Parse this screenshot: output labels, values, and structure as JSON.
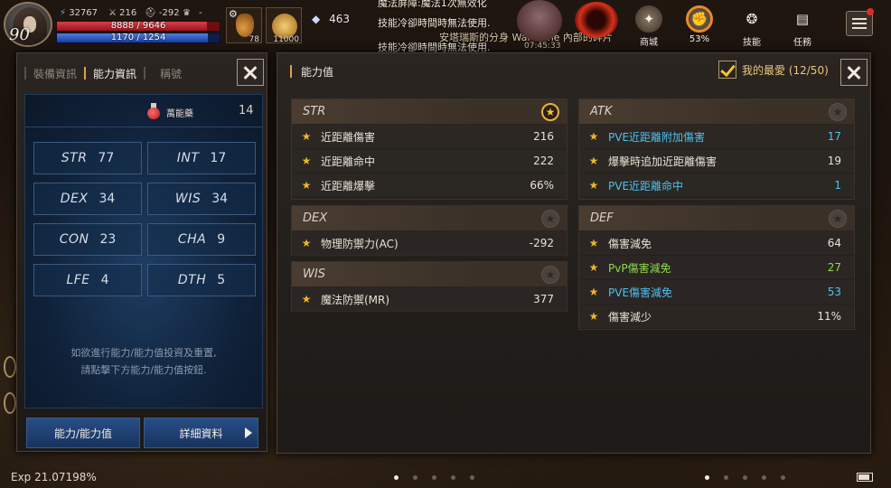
{
  "player": {
    "level": "90",
    "power": "32767",
    "attack_stat": "216",
    "defense_stat": "-292",
    "trophy_stat": "-",
    "hp_text": "8888 / 9646",
    "hp_ratio": 0.92,
    "mp_text": "1170 / 1254",
    "mp_ratio": 0.93
  },
  "quick_slots": [
    {
      "icon": "potion-slot-icon",
      "count": "78"
    },
    {
      "icon": "scroll-slot-icon",
      "count": "11000"
    }
  ],
  "crystal_count": "463",
  "system_messages": [
    "魔法屏障:魔法1次無效化",
    "技能冷卻時間時無法使用.",
    "安塔瑞斯的分身 War Zone 內部的碎片",
    "技能冷卻時間時無法使用."
  ],
  "timer_text": "07:45:33",
  "top_menu": [
    {
      "label": "商城",
      "icon": "shop-icon",
      "glyph": "✦"
    },
    {
      "label": "53%",
      "icon": "weight-icon",
      "glyph": "✊"
    },
    {
      "label": "技能",
      "icon": "skill-icon",
      "glyph": "❂"
    },
    {
      "label": "任務",
      "icon": "quest-icon",
      "glyph": "▤"
    }
  ],
  "left_panel": {
    "tabs": [
      {
        "label": "裝備資訊",
        "active": false
      },
      {
        "label": "能力資訊",
        "active": true
      },
      {
        "label": "稱號",
        "active": false
      }
    ],
    "potion_label": "萬能藥",
    "potion_count": "14",
    "stats": [
      {
        "key": "STR",
        "value": "77"
      },
      {
        "key": "INT",
        "value": "17"
      },
      {
        "key": "DEX",
        "value": "34"
      },
      {
        "key": "WIS",
        "value": "34"
      },
      {
        "key": "CON",
        "value": "23"
      },
      {
        "key": "CHA",
        "value": "9"
      },
      {
        "key": "LFE",
        "value": "4"
      },
      {
        "key": "DTH",
        "value": "5"
      }
    ],
    "hint_line1": "如欲進行能力/能力值投資及重置,",
    "hint_line2": "請點擊下方能力/能力值按鈕.",
    "button_ability": "能力/能力值",
    "button_details": "詳細資料"
  },
  "right_panel": {
    "title": "能力值",
    "favorite_label": "我的最愛 (12/50)",
    "sections": {
      "str": {
        "name": "STR",
        "starred": true,
        "rows": [
          {
            "label": "近距離傷害",
            "value": "216",
            "color": "#e8e2d6"
          },
          {
            "label": "近距離命中",
            "value": "222",
            "color": "#e8e2d6"
          },
          {
            "label": "近距離爆擊",
            "value": "66%",
            "color": "#e8e2d6"
          }
        ]
      },
      "dex": {
        "name": "DEX",
        "starred": false,
        "rows": [
          {
            "label": "物理防禦力(AC)",
            "value": "-292",
            "color": "#e8e2d6"
          }
        ]
      },
      "wis": {
        "name": "WIS",
        "starred": false,
        "rows": [
          {
            "label": "魔法防禦(MR)",
            "value": "377",
            "color": "#e8e2d6"
          }
        ]
      },
      "atk": {
        "name": "ATK",
        "starred": false,
        "rows": [
          {
            "label": "PVE近距離附加傷害",
            "value": "17",
            "color": "#4ec0f0"
          },
          {
            "label": "爆擊時追加近距離傷害",
            "value": "19",
            "color": "#e8e2d6"
          },
          {
            "label": "PVE近距離命中",
            "value": "1",
            "color": "#4ec0f0"
          }
        ]
      },
      "def": {
        "name": "DEF",
        "starred": false,
        "rows": [
          {
            "label": "傷害減免",
            "value": "64",
            "color": "#e8e2d6"
          },
          {
            "label": "PvP傷害減免",
            "value": "27",
            "color": "#8ed84a"
          },
          {
            "label": "PVE傷害減免",
            "value": "53",
            "color": "#4ec0f0"
          },
          {
            "label": "傷害減少",
            "value": "11%",
            "color": "#e8e2d6"
          }
        ]
      }
    }
  },
  "exp_text": "Exp 21.07198%",
  "colors": {
    "accent_gold": "#d9a34a",
    "star_gold": "#f0b428",
    "pve_blue": "#4ec0f0",
    "pvp_green": "#8ed84a",
    "hp_red": "#d64048",
    "mp_blue": "#4c7ee0"
  }
}
